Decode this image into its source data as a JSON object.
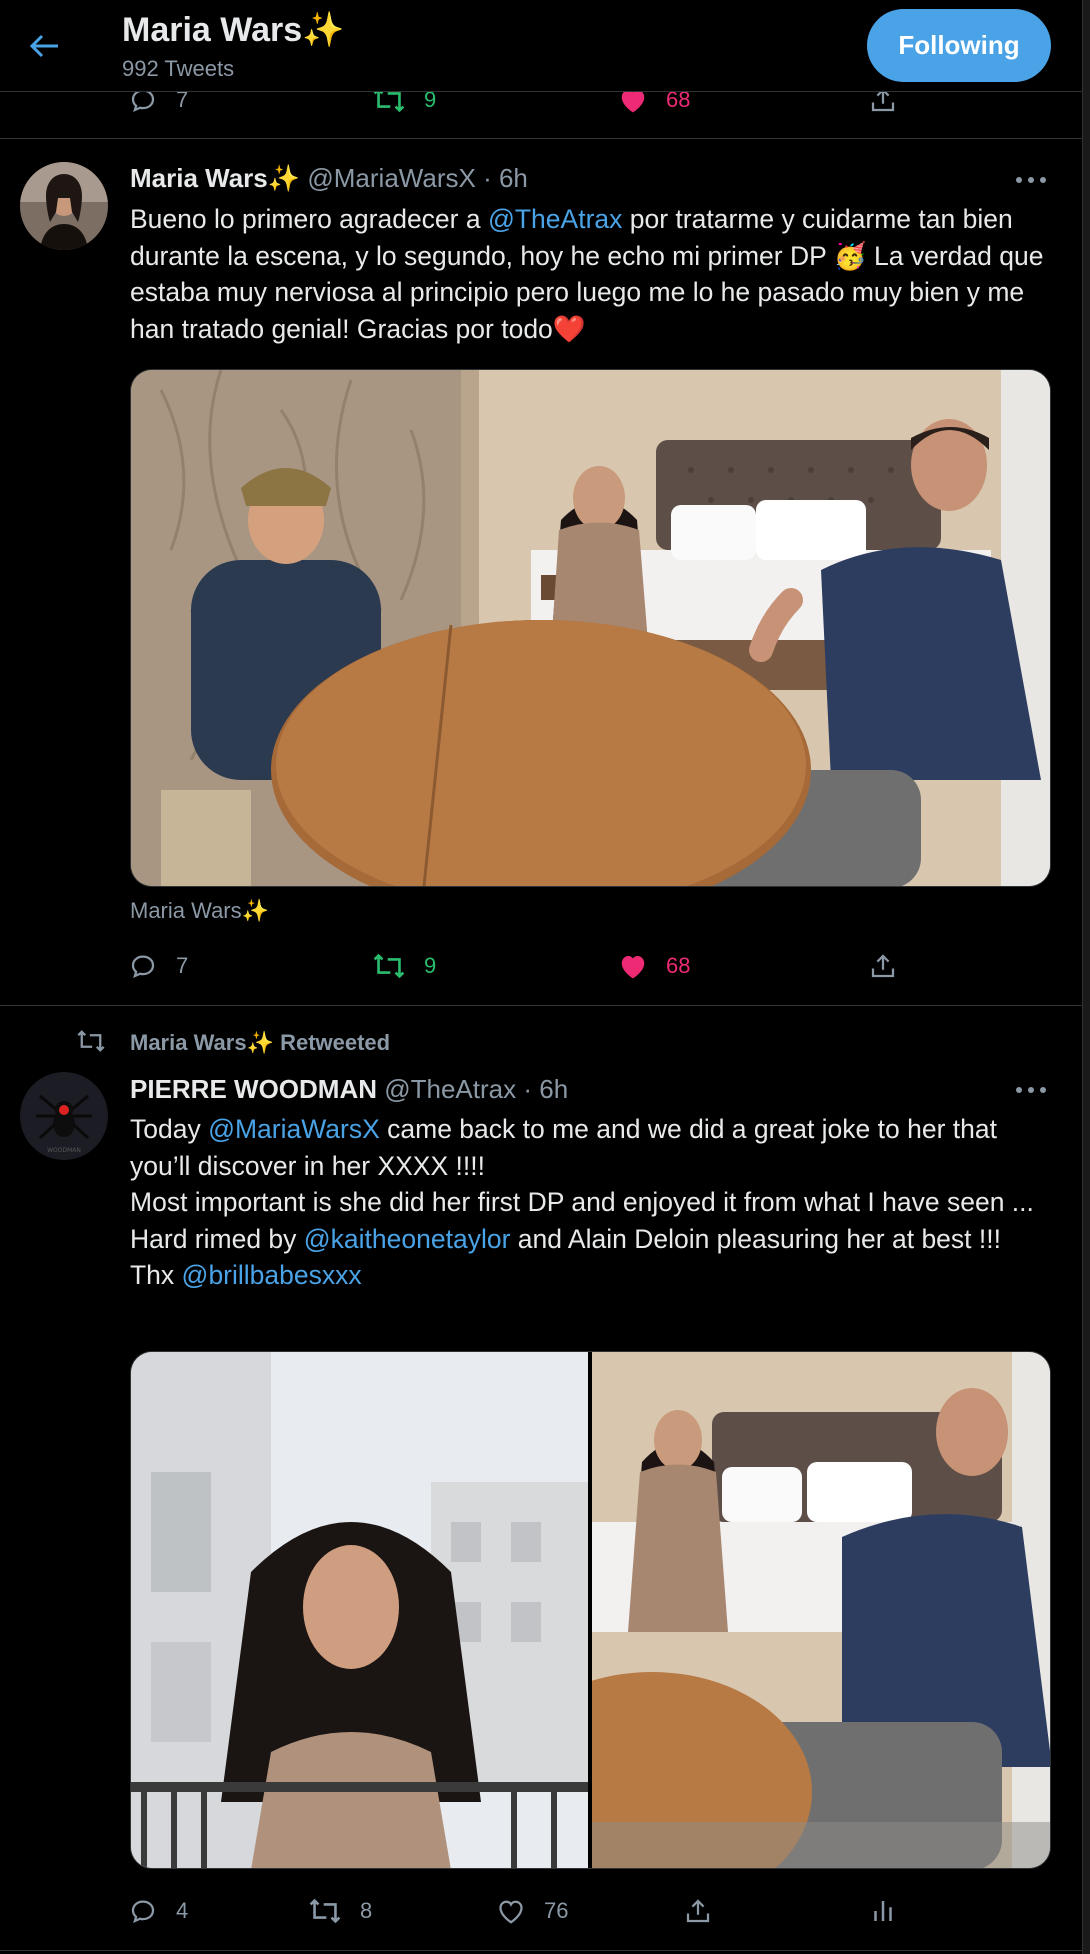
{
  "header": {
    "title": "Maria Wars✨",
    "subtitle": "992 Tweets",
    "follow_label": "Following"
  },
  "top_stats": {
    "replies": "7",
    "retweets": "9",
    "likes": "68"
  },
  "tweet1": {
    "name": "Maria Wars✨",
    "handle": "@MariaWarsX",
    "time": "· 6h",
    "text_1": "Bueno lo primero agradecer a ",
    "mention_1": "@TheAtrax",
    "text_2": " por tratarme y cuidarme tan bien durante la escena, y lo segundo, hoy he echo mi primer DP 🥳 La verdad que estaba muy nerviosa al principio pero luego me lo he pasado muy bien y me han tratado genial! Gracias por todo❤️",
    "caption": "Maria Wars✨",
    "replies": "7",
    "retweets": "9",
    "likes": "68"
  },
  "tweet2": {
    "retweeted_by": "Maria Wars✨ Retweeted",
    "name": "PIERRE WOODMAN",
    "handle": "@TheAtrax",
    "time": "· 6h",
    "l1_a": "Today ",
    "l1_mention": "@MariaWarsX",
    "l1_b": " came back to me and we did a great joke to her that you’ll discover in her XXXX !!!!",
    "l2": "Most important is she did her first DP and enjoyed it from what I have seen ...",
    "l3_a": "Hard rimed by ",
    "l3_mention": "@kaitheonetaylor",
    "l3_b": " and Alain Deloin pleasuring her at best !!!",
    "l4_a": "Thx ",
    "l4_mention": "@brillbabesxxx",
    "replies": "4",
    "retweets": "8",
    "likes": "76"
  },
  "colors": {
    "accent": "#4aa3e6",
    "retweet": "#2bbd6e",
    "like": "#ee2a74",
    "muted": "#8b98a5"
  },
  "icons": [
    "back-arrow-icon",
    "reply-icon",
    "retweet-icon",
    "heart-icon",
    "share-icon",
    "analytics-icon",
    "more-icon"
  ]
}
